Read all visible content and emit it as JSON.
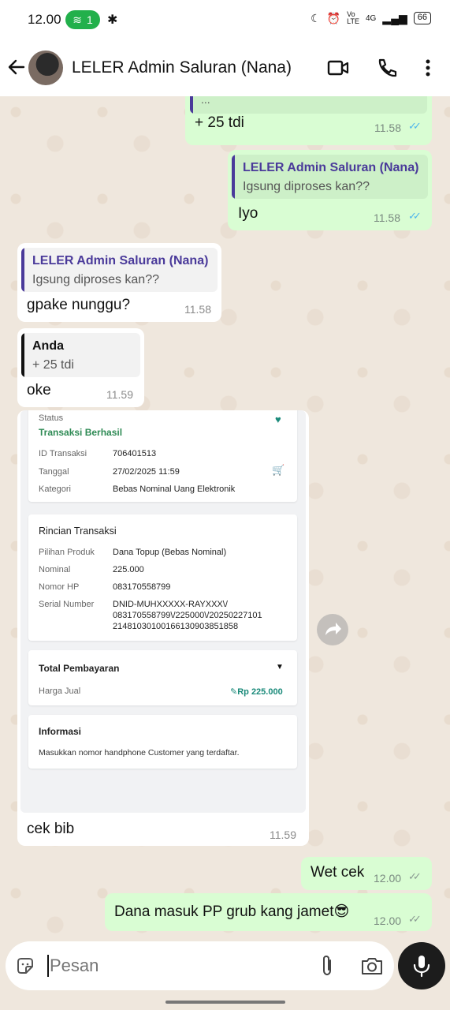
{
  "status_bar": {
    "time": "12.00",
    "hotspot_count": "1",
    "network": "4G",
    "battery": "66"
  },
  "header": {
    "title": "LELER Admin Saluran (Nana)"
  },
  "colors": {
    "outgoing_bubble": "#d9fdd3",
    "incoming_bubble": "#ffffff",
    "accent_purple": "#4a3a9a",
    "read_ticks": "#4fb6ec",
    "receipt_green": "#2e8a54"
  },
  "messages": [
    {
      "direction": "out",
      "quote_text": "...",
      "text": "+ 25 tdi",
      "time": "11.58",
      "status": "read"
    },
    {
      "direction": "out",
      "quote_name": "LELER Admin Saluran (Nana)",
      "quote_text": "Igsung diproses kan??",
      "text": "Iyo",
      "time": "11.58",
      "status": "read"
    },
    {
      "direction": "in",
      "quote_name": "LELER Admin Saluran (Nana)",
      "quote_text": "Igsung diproses kan??",
      "text": "gpake nunggu?",
      "time": "11.58"
    },
    {
      "direction": "in",
      "quote_name": "Anda",
      "quote_text": "+ 25 tdi",
      "text": "oke",
      "time": "11.59"
    },
    {
      "direction": "in",
      "type": "image",
      "caption": "cek bib",
      "time": "11.59"
    },
    {
      "direction": "out",
      "text": "Wet cek",
      "time": "12.00",
      "status": "delivered"
    },
    {
      "direction": "out",
      "text": "Dana masuk PP grub kang jamet😎",
      "time": "12.00",
      "status": "delivered"
    }
  ],
  "receipt": {
    "status_label": "Status",
    "status_value": "Transaksi Berhasil",
    "summary_rows": [
      {
        "label": "ID Transaksi",
        "value": "706401513"
      },
      {
        "label": "Tanggal",
        "value": "27/02/2025 11:59"
      },
      {
        "label": "Kategori",
        "value": "Bebas Nominal Uang Elektronik"
      }
    ],
    "details_title": "Rincian Transaksi",
    "detail_rows": [
      {
        "label": "Pilihan Produk",
        "value": "Dana Topup (Bebas Nominal)"
      },
      {
        "label": "Nominal",
        "value": "225.000"
      },
      {
        "label": "Nomor HP",
        "value": "083170558799"
      },
      {
        "label": "Serial Number",
        "value_lines": [
          "DNID-MUHXXXXX-RAYXXX\\/",
          "083170558799\\/225000\\/20250227101",
          "21481030100166130903851858"
        ]
      }
    ],
    "total_title": "Total Pembayaran",
    "price_label": "Harga Jual",
    "price_value": "Rp 225.000",
    "info_title": "Informasi",
    "info_text": "Masukkan nomor handphone Customer yang terdaftar."
  },
  "input": {
    "placeholder": "Pesan"
  }
}
